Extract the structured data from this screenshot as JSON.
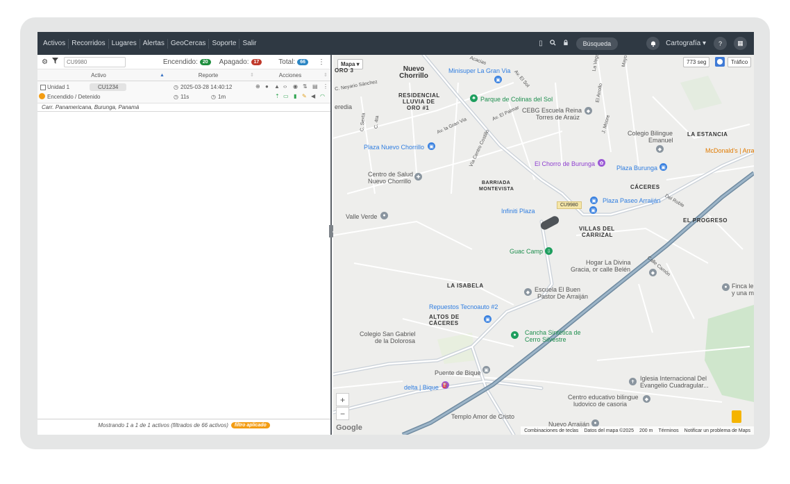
{
  "nav": {
    "items": [
      "Activos",
      "Recorridos",
      "Lugares",
      "Alertas",
      "GeoCercas",
      "Soporte",
      "Salir"
    ],
    "search_label": "Búsqueda",
    "carto_label": "Cartografía ▾",
    "help_glyph": "?",
    "apps_glyph": "▦"
  },
  "toolbar": {
    "search_value": "CU9980",
    "on_label": "Encendido:",
    "on_count": "20",
    "off_label": "Apagado:",
    "off_count": "17",
    "total_label": "Total:",
    "total_count": "66"
  },
  "columns": {
    "asset": "Activo",
    "report": "Reporte",
    "actions": "Acciones"
  },
  "row": {
    "unit": "Unidad 1",
    "plate": "CU1234",
    "status": "Encendido / Detenido",
    "datetime": "2025-03-28 14:40:12",
    "elapsed1": "11s",
    "elapsed2": "1m",
    "route": "Carr. Panamericana, Burunga, Panamá"
  },
  "footer": {
    "text": "Mostrando 1 a 1 de 1 activos (filtrados de 66 activos)",
    "pill": "filtro aplicado"
  },
  "map": {
    "type_label": "Mapa ▾",
    "age_label": "773 seg",
    "traffic_label": "Tráfico",
    "vehicle_tag": "CU9980",
    "attribution": {
      "shortcuts": "Combinaciones de teclas",
      "data": "Datos del mapa ©2025",
      "scale": "200 m",
      "terms": "Términos",
      "report": "Notificar un problema de Maps"
    },
    "logo": "Google",
    "labels": {
      "nuevo_chorrillo": "Nuevo Chorrillo",
      "residencial": "RESIDENCIAL",
      "lluvia": "LLUVIA DE",
      "oro1": "ORO #1",
      "oro3": "ORO 3",
      "minisuper": "Minisuper La Gran Via",
      "parque": "Parque de Colinas del Sol",
      "cebg": "CEBG Escuela Reina",
      "torres": "Torres de Araúz",
      "colegio_bilingue": "Colegio Bilingue",
      "emanuel": "Emanuel",
      "la_estancia": "LA ESTANCIA",
      "mcdonalds": "McDonald's | Arra",
      "plaza_nc": "Plaza Nuevo Chorrillo",
      "chorro": "El Chorro de Burunga",
      "plaza_burunga": "Plaza Burunga",
      "centro_salud": "Centro de Salud",
      "nuevo_chorrillo2": "Nuevo Chorrillo",
      "barriada": "BARRIADA",
      "montevista": "MONTEVISTA",
      "caceres": "CÁCERES",
      "plaza_paseo": "Plaza Paseo Arraiján",
      "infiniti": "Infiniti Plaza",
      "valle_verde": "Valle Verde",
      "el_progreso": "EL PROGRESO",
      "villas": "VILLAS DEL",
      "carrizal": "CARRIZAL",
      "guac_camp": "Guac Camp",
      "hogar": "Hogar La Divina",
      "gracia": "Gracia, or calle Belén",
      "la_isabela": "LA ISABELA",
      "escuela": "Escuela El Buen",
      "pastor": "Pastor De Arraiján",
      "finca1": "Finca le",
      "finca2": "y una m",
      "repuestos": "Repuestos Tecnoauto #2",
      "altos": "ALTOS DE",
      "caceres2": "CÁCERES",
      "colegio_sg": "Colegio San Gabriel",
      "dolorosa": "de la Dolorosa",
      "cancha": "Cancha Sintética de",
      "cerro": "Cerro Silvestre",
      "puente": "Puente de Bique",
      "delta": "delta | Bique",
      "iglesia": "Iglesia Internacional Del",
      "evangelio": "Evangelio Cuadragular...",
      "centro_edu": "Centro educativo bilingue",
      "ludovico": "ludovico de casoria",
      "templo": "Templo Amor de Cristo",
      "nuevo_arraijan": "Nuevo Arraiján",
      "av_gran_via": "Av. la Gran Via",
      "av_el_palmar": "Av. El Palmar",
      "el_sol": "Av. El Sol",
      "el_arrollo": "El Arrollo",
      "j_moore": "J. Moore",
      "via_centro": "Vía Centro Costillo",
      "del_roble": "Del Roble",
      "calle_camon": "Calle Camón",
      "c_neyario": "C. Neyario Sánchez",
      "c_sexta": "C. Sexta",
      "c_4ta": "C. 4ta",
      "acacias": "Acacias",
      "mayo": "Mayo",
      "la_vega": "La Vega",
      "heredia": "eredia"
    }
  }
}
